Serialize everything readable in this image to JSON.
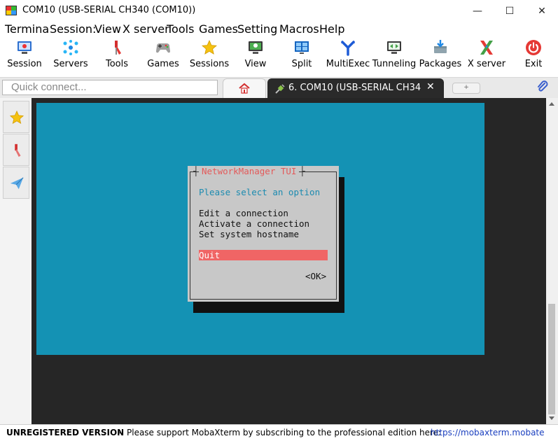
{
  "window": {
    "title": "COM10  (USB-SERIAL CH340 (COM10))",
    "controls": {
      "minimize": "—",
      "maximize": "☐",
      "close": "✕"
    }
  },
  "menu": [
    "Termina",
    "Session:",
    "View",
    "X server",
    "Tools",
    "Games",
    "Setting",
    "Macros",
    "Help"
  ],
  "toolbar": [
    {
      "label": "Session",
      "icon": "session-icon"
    },
    {
      "label": "Servers",
      "icon": "servers-icon"
    },
    {
      "label": "Tools",
      "icon": "tools-icon"
    },
    {
      "label": "Games",
      "icon": "games-icon"
    },
    {
      "label": "Sessions",
      "icon": "sessions-star-icon"
    },
    {
      "label": "View",
      "icon": "view-icon"
    },
    {
      "label": "Split",
      "icon": "split-icon"
    },
    {
      "label": "MultiExec",
      "icon": "multiexec-icon"
    },
    {
      "label": "Tunneling",
      "icon": "tunneling-icon"
    },
    {
      "label": "Packages",
      "icon": "packages-icon"
    },
    {
      "label": "X server",
      "icon": "x-server-icon"
    },
    {
      "label": "Exit",
      "icon": "exit-power-icon"
    }
  ],
  "quick_connect": {
    "placeholder": "Quick connect..."
  },
  "tabs": {
    "home_icon": "home-icon",
    "session_tab": {
      "label": "6. COM10  (USB-SERIAL CH34",
      "close": "✕"
    },
    "new_tab": "+"
  },
  "terminal": {
    "dialog_title": "NetworkManager TUI",
    "prompt": "Please select an option",
    "options": [
      "Edit a connection",
      "Activate a connection",
      "Set system hostname"
    ],
    "selected": "Quit",
    "ok": "<OK>"
  },
  "statusbar": {
    "unregistered": "UNREGISTERED VERSION",
    "dash": "-",
    "message": "Please support MobaXterm by subscribing to the professional edition here:",
    "link": "https://mobaxterm.mobate"
  },
  "colors": {
    "tui_background": "#1492b4",
    "dialog_gray": "#c8c8c8",
    "selection_red": "#f06565",
    "title_red": "#e35a5a",
    "terminal_dark": "#262626"
  }
}
